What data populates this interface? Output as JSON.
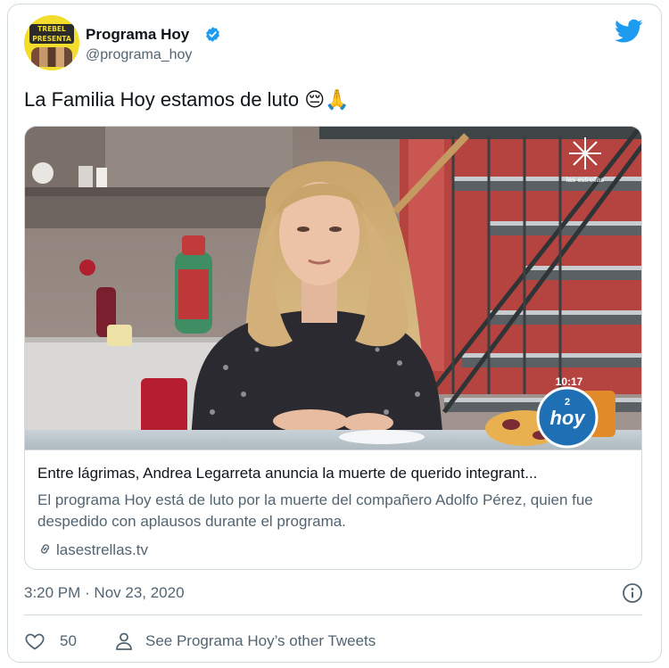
{
  "author": {
    "name": "Programa Hoy",
    "handle": "@programa_hoy",
    "verified": true,
    "avatar_text": [
      "TREBEL",
      "PRESENTA"
    ]
  },
  "tweet": {
    "text": "La Familia Hoy estamos de luto",
    "emojis": "😔🙏"
  },
  "card": {
    "image_overlay": {
      "time": "10:17",
      "channel_logo_text": "hoy",
      "channel_number": "2",
      "network_text": "las estrellas"
    },
    "title": "Entre lágrimas, Andrea Legarreta anuncia la muerte de querido integrant...",
    "description": "El programa Hoy está de luto por la muerte del compañero Adolfo Pérez, quien fue despedido con aplausos durante el programa.",
    "domain": "lasestrellas.tv"
  },
  "meta": {
    "timestamp": "3:20 PM · Nov 23, 2020"
  },
  "actions": {
    "like_count": "50",
    "other_tweets_label": "See Programa Hoy’s other Tweets"
  },
  "colors": {
    "twitter_blue": "#1d9bf0",
    "secondary_text": "#536471",
    "border": "#cfd9de"
  },
  "icons": {
    "brand": "twitter-bird-icon",
    "verified": "verified-badge-icon",
    "link": "link-icon",
    "info": "info-icon",
    "like": "heart-icon",
    "profile": "person-icon"
  }
}
